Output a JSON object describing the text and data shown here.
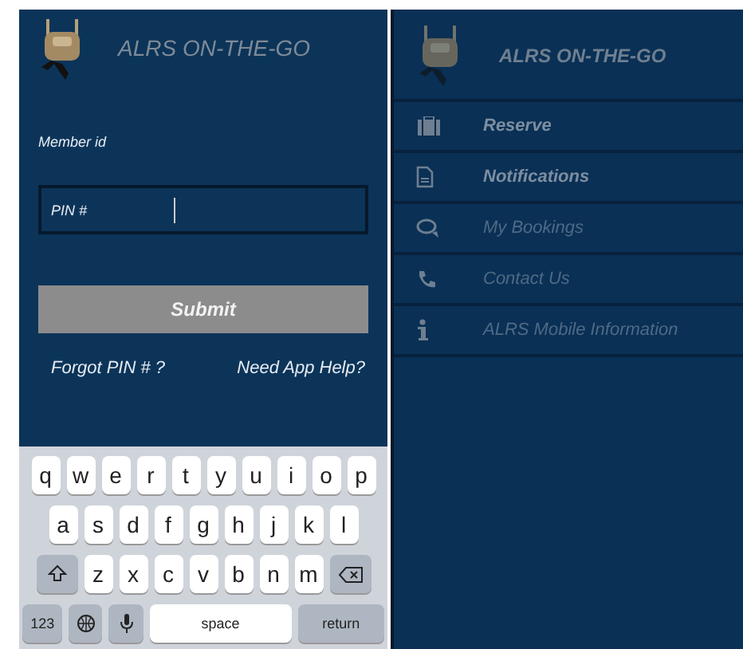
{
  "login": {
    "title": "ALRS ON-THE-GO",
    "member_label": "Member id",
    "pin": {
      "placeholder": "PIN #"
    },
    "submit": "Submit",
    "links": [
      "Forgot PIN # ?",
      "Need App Help?"
    ]
  },
  "keyboard": {
    "rows": [
      {
        "keys": [
          {
            "kind": "letter",
            "label": "q"
          },
          {
            "kind": "letter",
            "label": "w"
          },
          {
            "kind": "letter",
            "label": "e"
          },
          {
            "kind": "letter",
            "label": "r"
          },
          {
            "kind": "letter",
            "label": "t"
          },
          {
            "kind": "letter",
            "label": "y"
          },
          {
            "kind": "letter",
            "label": "u"
          },
          {
            "kind": "letter",
            "label": "i"
          },
          {
            "kind": "letter",
            "label": "o"
          },
          {
            "kind": "letter",
            "label": "p"
          }
        ]
      },
      {
        "keys": [
          {
            "kind": "letter",
            "label": "a"
          },
          {
            "kind": "letter",
            "label": "s"
          },
          {
            "kind": "letter",
            "label": "d"
          },
          {
            "kind": "letter",
            "label": "f"
          },
          {
            "kind": "letter",
            "label": "g"
          },
          {
            "kind": "letter",
            "label": "h"
          },
          {
            "kind": "letter",
            "label": "j"
          },
          {
            "kind": "letter",
            "label": "k"
          },
          {
            "kind": "letter",
            "label": "l"
          }
        ]
      },
      {
        "keys": [
          {
            "kind": "shift"
          },
          {
            "kind": "letter",
            "label": "z"
          },
          {
            "kind": "letter",
            "label": "x"
          },
          {
            "kind": "letter",
            "label": "c"
          },
          {
            "kind": "letter",
            "label": "v"
          },
          {
            "kind": "letter",
            "label": "b"
          },
          {
            "kind": "letter",
            "label": "n"
          },
          {
            "kind": "letter",
            "label": "m"
          },
          {
            "kind": "delete"
          }
        ]
      },
      {
        "keys": [
          {
            "kind": "function",
            "label": "123"
          },
          {
            "kind": "globe"
          },
          {
            "kind": "mic"
          },
          {
            "kind": "space",
            "label": "space"
          },
          {
            "kind": "function",
            "label": "return"
          }
        ]
      }
    ]
  },
  "menu": {
    "title": "ALRS ON-THE-GO",
    "items": [
      {
        "kind": "suitcase",
        "label": "Reserve",
        "bold": true
      },
      {
        "kind": "document",
        "label": "Notifications",
        "bold": true
      },
      {
        "kind": "chat",
        "label": "My Bookings",
        "bold": false
      },
      {
        "kind": "phone",
        "label": "Contact Us",
        "bold": false
      },
      {
        "kind": "info",
        "label": "ALRS Mobile Information",
        "bold": false
      }
    ]
  }
}
